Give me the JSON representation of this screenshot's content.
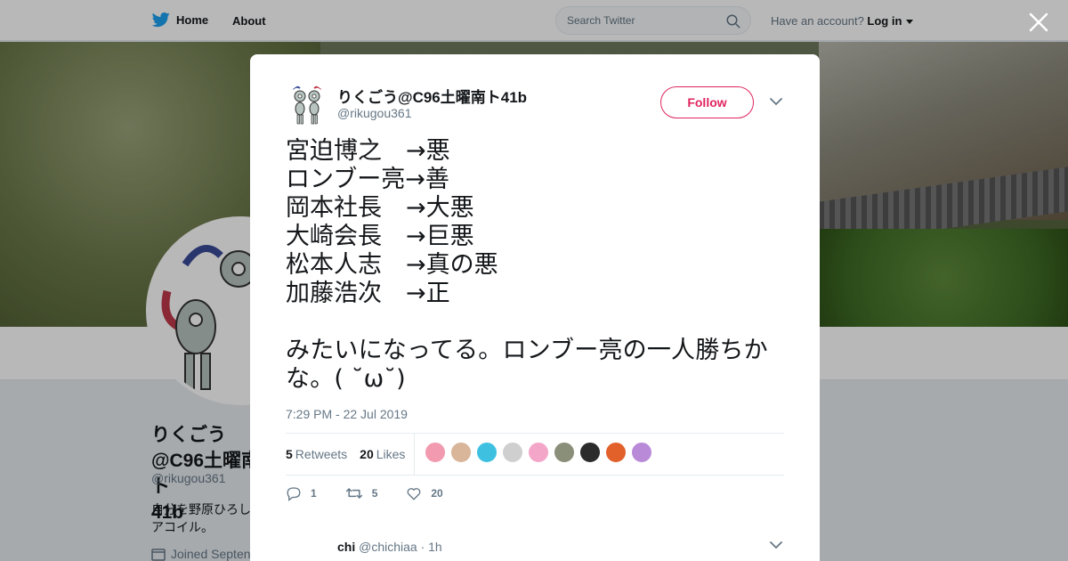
{
  "nav": {
    "home_label": "Home",
    "about_label": "About",
    "search_placeholder": "Search Twitter",
    "account_prompt": "Have an account?",
    "login_label": "Log in"
  },
  "profile": {
    "name": "りくごう@C96土曜南ト\n41b",
    "handle": "@rikugou361",
    "bio_line1": "自分を野原ひろし",
    "bio_line2": "アコイル。",
    "joined": "Joined Septen"
  },
  "tweet": {
    "author_name": "りくごう@C96土曜南ト41b",
    "author_handle": "@rikugou361",
    "follow_label": "Follow",
    "lines": [
      "宮迫博之　→悪",
      "ロンブー亮→善",
      "岡本社長　→大悪",
      "大崎会長　→巨悪",
      "松本人志　→真の悪",
      "加藤浩次　→正"
    ],
    "paragraph": "みたいになってる。ロンブー亮の一人勝ちかな。( ˘ω˘)",
    "timestamp": "7:29 PM - 22 Jul 2019",
    "retweets_count": "5",
    "retweets_label": "Retweets",
    "likes_count": "20",
    "likes_label": "Likes",
    "liker_colors": [
      "#f29bb0",
      "#d9b59a",
      "#3ec1e0",
      "#cfcfcf",
      "#f4a6c8",
      "#8a8f7a",
      "#2b2b2b",
      "#e2612b",
      "#b98ad8"
    ],
    "reply_count": "1",
    "retweet_count_action": "5",
    "like_count_action": "20"
  },
  "reply": {
    "name": "chi",
    "handle": "@chichiaa",
    "time": "· 1h"
  },
  "colors": {
    "twitter_blue": "#1da1f2",
    "follow_pink": "#e0245e"
  }
}
